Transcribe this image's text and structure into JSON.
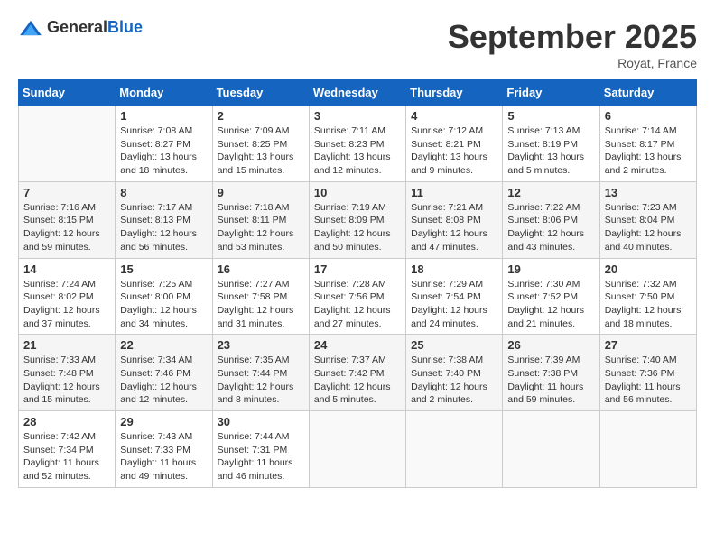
{
  "header": {
    "logo_general": "General",
    "logo_blue": "Blue",
    "title": "September 2025",
    "location": "Royat, France"
  },
  "calendar": {
    "days_of_week": [
      "Sunday",
      "Monday",
      "Tuesday",
      "Wednesday",
      "Thursday",
      "Friday",
      "Saturday"
    ],
    "weeks": [
      [
        {
          "day": "",
          "info": ""
        },
        {
          "day": "1",
          "info": "Sunrise: 7:08 AM\nSunset: 8:27 PM\nDaylight: 13 hours\nand 18 minutes."
        },
        {
          "day": "2",
          "info": "Sunrise: 7:09 AM\nSunset: 8:25 PM\nDaylight: 13 hours\nand 15 minutes."
        },
        {
          "day": "3",
          "info": "Sunrise: 7:11 AM\nSunset: 8:23 PM\nDaylight: 13 hours\nand 12 minutes."
        },
        {
          "day": "4",
          "info": "Sunrise: 7:12 AM\nSunset: 8:21 PM\nDaylight: 13 hours\nand 9 minutes."
        },
        {
          "day": "5",
          "info": "Sunrise: 7:13 AM\nSunset: 8:19 PM\nDaylight: 13 hours\nand 5 minutes."
        },
        {
          "day": "6",
          "info": "Sunrise: 7:14 AM\nSunset: 8:17 PM\nDaylight: 13 hours\nand 2 minutes."
        }
      ],
      [
        {
          "day": "7",
          "info": "Sunrise: 7:16 AM\nSunset: 8:15 PM\nDaylight: 12 hours\nand 59 minutes."
        },
        {
          "day": "8",
          "info": "Sunrise: 7:17 AM\nSunset: 8:13 PM\nDaylight: 12 hours\nand 56 minutes."
        },
        {
          "day": "9",
          "info": "Sunrise: 7:18 AM\nSunset: 8:11 PM\nDaylight: 12 hours\nand 53 minutes."
        },
        {
          "day": "10",
          "info": "Sunrise: 7:19 AM\nSunset: 8:09 PM\nDaylight: 12 hours\nand 50 minutes."
        },
        {
          "day": "11",
          "info": "Sunrise: 7:21 AM\nSunset: 8:08 PM\nDaylight: 12 hours\nand 47 minutes."
        },
        {
          "day": "12",
          "info": "Sunrise: 7:22 AM\nSunset: 8:06 PM\nDaylight: 12 hours\nand 43 minutes."
        },
        {
          "day": "13",
          "info": "Sunrise: 7:23 AM\nSunset: 8:04 PM\nDaylight: 12 hours\nand 40 minutes."
        }
      ],
      [
        {
          "day": "14",
          "info": "Sunrise: 7:24 AM\nSunset: 8:02 PM\nDaylight: 12 hours\nand 37 minutes."
        },
        {
          "day": "15",
          "info": "Sunrise: 7:25 AM\nSunset: 8:00 PM\nDaylight: 12 hours\nand 34 minutes."
        },
        {
          "day": "16",
          "info": "Sunrise: 7:27 AM\nSunset: 7:58 PM\nDaylight: 12 hours\nand 31 minutes."
        },
        {
          "day": "17",
          "info": "Sunrise: 7:28 AM\nSunset: 7:56 PM\nDaylight: 12 hours\nand 27 minutes."
        },
        {
          "day": "18",
          "info": "Sunrise: 7:29 AM\nSunset: 7:54 PM\nDaylight: 12 hours\nand 24 minutes."
        },
        {
          "day": "19",
          "info": "Sunrise: 7:30 AM\nSunset: 7:52 PM\nDaylight: 12 hours\nand 21 minutes."
        },
        {
          "day": "20",
          "info": "Sunrise: 7:32 AM\nSunset: 7:50 PM\nDaylight: 12 hours\nand 18 minutes."
        }
      ],
      [
        {
          "day": "21",
          "info": "Sunrise: 7:33 AM\nSunset: 7:48 PM\nDaylight: 12 hours\nand 15 minutes."
        },
        {
          "day": "22",
          "info": "Sunrise: 7:34 AM\nSunset: 7:46 PM\nDaylight: 12 hours\nand 12 minutes."
        },
        {
          "day": "23",
          "info": "Sunrise: 7:35 AM\nSunset: 7:44 PM\nDaylight: 12 hours\nand 8 minutes."
        },
        {
          "day": "24",
          "info": "Sunrise: 7:37 AM\nSunset: 7:42 PM\nDaylight: 12 hours\nand 5 minutes."
        },
        {
          "day": "25",
          "info": "Sunrise: 7:38 AM\nSunset: 7:40 PM\nDaylight: 12 hours\nand 2 minutes."
        },
        {
          "day": "26",
          "info": "Sunrise: 7:39 AM\nSunset: 7:38 PM\nDaylight: 11 hours\nand 59 minutes."
        },
        {
          "day": "27",
          "info": "Sunrise: 7:40 AM\nSunset: 7:36 PM\nDaylight: 11 hours\nand 56 minutes."
        }
      ],
      [
        {
          "day": "28",
          "info": "Sunrise: 7:42 AM\nSunset: 7:34 PM\nDaylight: 11 hours\nand 52 minutes."
        },
        {
          "day": "29",
          "info": "Sunrise: 7:43 AM\nSunset: 7:33 PM\nDaylight: 11 hours\nand 49 minutes."
        },
        {
          "day": "30",
          "info": "Sunrise: 7:44 AM\nSunset: 7:31 PM\nDaylight: 11 hours\nand 46 minutes."
        },
        {
          "day": "",
          "info": ""
        },
        {
          "day": "",
          "info": ""
        },
        {
          "day": "",
          "info": ""
        },
        {
          "day": "",
          "info": ""
        }
      ]
    ]
  }
}
